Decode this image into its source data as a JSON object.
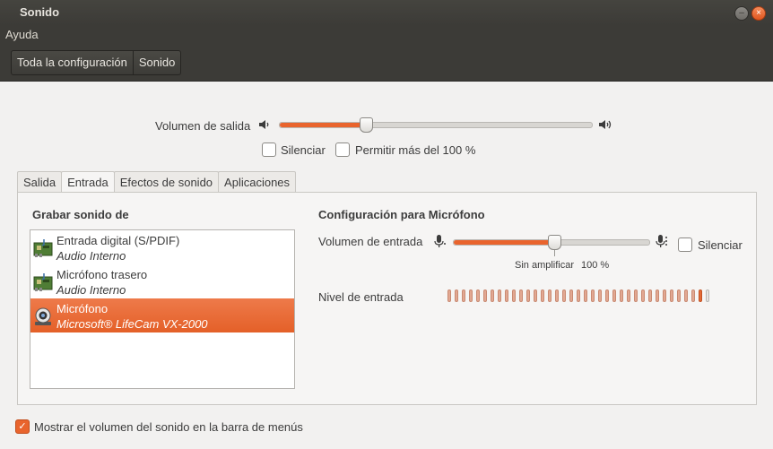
{
  "window": {
    "title": "Sonido"
  },
  "menubar": {
    "help": "Ayuda"
  },
  "breadcrumb": {
    "items": [
      "Toda la configuración",
      "Sonido"
    ]
  },
  "output": {
    "label": "Volumen de salida",
    "volume_fraction": 0.28,
    "mute_label": "Silenciar",
    "mute_checked": false,
    "overamplify_label": "Permitir más del 100 %",
    "overamplify_checked": false
  },
  "tabs": [
    "Salida",
    "Entrada",
    "Efectos de sonido",
    "Aplicaciones"
  ],
  "active_tab": "Entrada",
  "input": {
    "record_heading": "Grabar sonido de",
    "devices": [
      {
        "name": "Entrada digital (S/PDIF)",
        "subtitle": "Audio Interno",
        "icon": "sound-card-icon",
        "selected": false
      },
      {
        "name": "Micrófono trasero",
        "subtitle": "Audio Interno",
        "icon": "sound-card-icon",
        "selected": false
      },
      {
        "name": "Micrófono",
        "subtitle": "Microsoft® LifeCam VX-2000",
        "icon": "webcam-icon",
        "selected": true
      }
    ],
    "config_heading": "Configuración para Micrófono",
    "volume_label": "Volumen de entrada",
    "volume_fraction": 0.52,
    "mute_label": "Silenciar",
    "mute_checked": false,
    "unamplified_label": "Sin amplificar",
    "percent_label": "100 %",
    "level_label": "Nivel de entrada",
    "level_segments_total": 37,
    "level_segments_lit": 36
  },
  "footer": {
    "show_volume_label": "Mostrar el volumen del sonido en la barra de menús",
    "show_volume_checked": true
  },
  "colors": {
    "accent": "#e9642d",
    "titlebar": "#3c3b37"
  }
}
